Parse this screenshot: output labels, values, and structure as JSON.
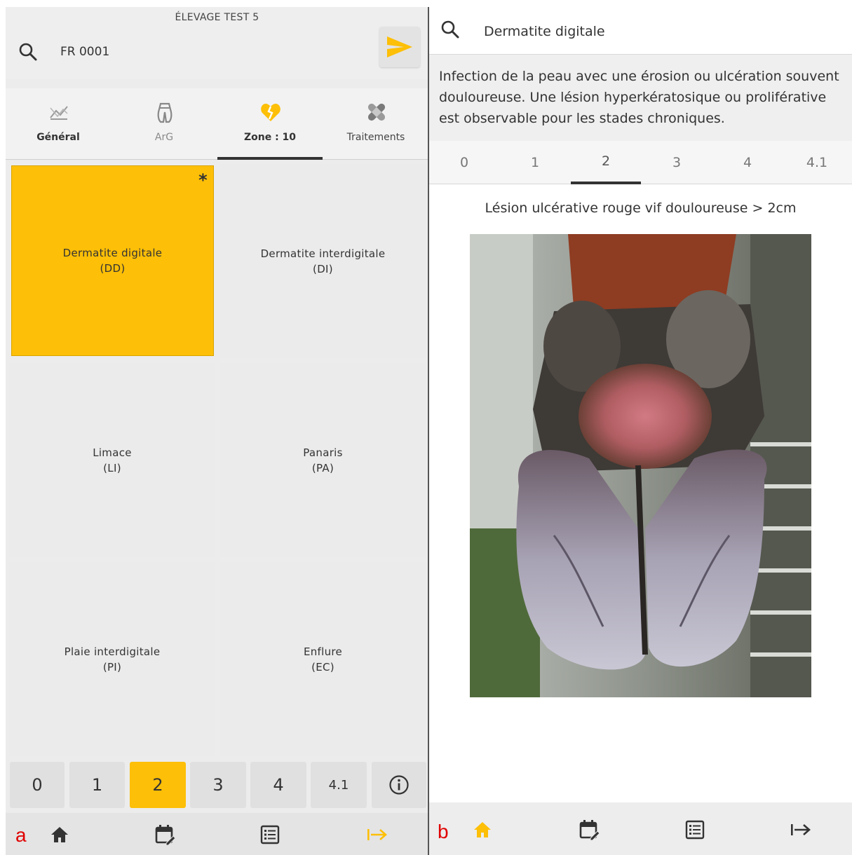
{
  "panel_a": {
    "label": "a",
    "farm_name": "ÉLEVAGE TEST 5",
    "animal_id": "FR 0001",
    "tabs": [
      {
        "label": "Général",
        "icon": "chart-icon"
      },
      {
        "label": "ArG",
        "icon": "hoof-icon"
      },
      {
        "label": "Zone : 10",
        "icon": "broken-heart-icon"
      },
      {
        "label": "Traitements",
        "icon": "bandage-icon"
      }
    ],
    "lesions": [
      {
        "name": "Dermatite digitale",
        "code": "(DD)",
        "marker": "*"
      },
      {
        "name": "Dermatite interdigitale",
        "code": "(DI)"
      },
      {
        "name": "Limace",
        "code": "(LI)"
      },
      {
        "name": "Panaris",
        "code": "(PA)"
      },
      {
        "name": "Plaie interdigitale",
        "code": "(PI)"
      },
      {
        "name": "Enflure",
        "code": "(EC)"
      }
    ],
    "grades": [
      "0",
      "1",
      "2",
      "3",
      "4",
      "4.1"
    ],
    "selected_grade": "2"
  },
  "panel_b": {
    "label": "b",
    "search_text": "Dermatite digitale",
    "description": "Infection de la peau avec une érosion ou ulcération souvent douloureuse. Une lésion hyperkératosique ou proliférative est observable pour les stades chroniques.",
    "stages": [
      "0",
      "1",
      "2",
      "3",
      "4",
      "4.1"
    ],
    "selected_stage": "2",
    "stage_caption": "Lésion ulcérative rouge vif douloureuse > 2cm"
  },
  "colors": {
    "accent": "#fdbf07",
    "panel_label": "#e00000"
  }
}
